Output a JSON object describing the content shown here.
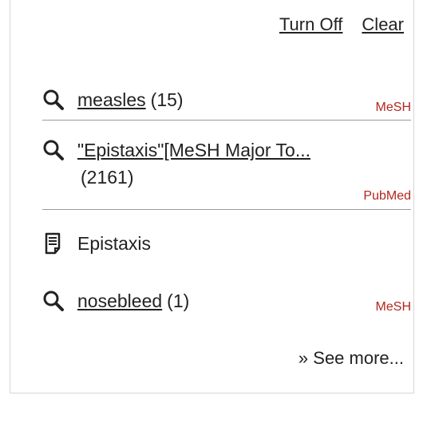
{
  "header": {
    "turn_off_label": "Turn Off",
    "clear_label": "Clear"
  },
  "items": [
    {
      "icon": "search-icon",
      "link": "measles",
      "count": "(15)",
      "source": "MeSH"
    },
    {
      "icon": "search-icon",
      "link": "\"Epistaxis\"[MeSH Major To...",
      "count": "(2161)",
      "source": "PubMed"
    },
    {
      "icon": "document-icon",
      "text": "Epistaxis"
    },
    {
      "icon": "search-icon",
      "link": "nosebleed",
      "count": "(1)",
      "source": "MeSH"
    }
  ],
  "footer": {
    "see_more_label": "» See more..."
  },
  "colors": {
    "source_label": "#b3261e",
    "separator": "#9a9a9a",
    "panel_border": "#d6d6d6"
  }
}
